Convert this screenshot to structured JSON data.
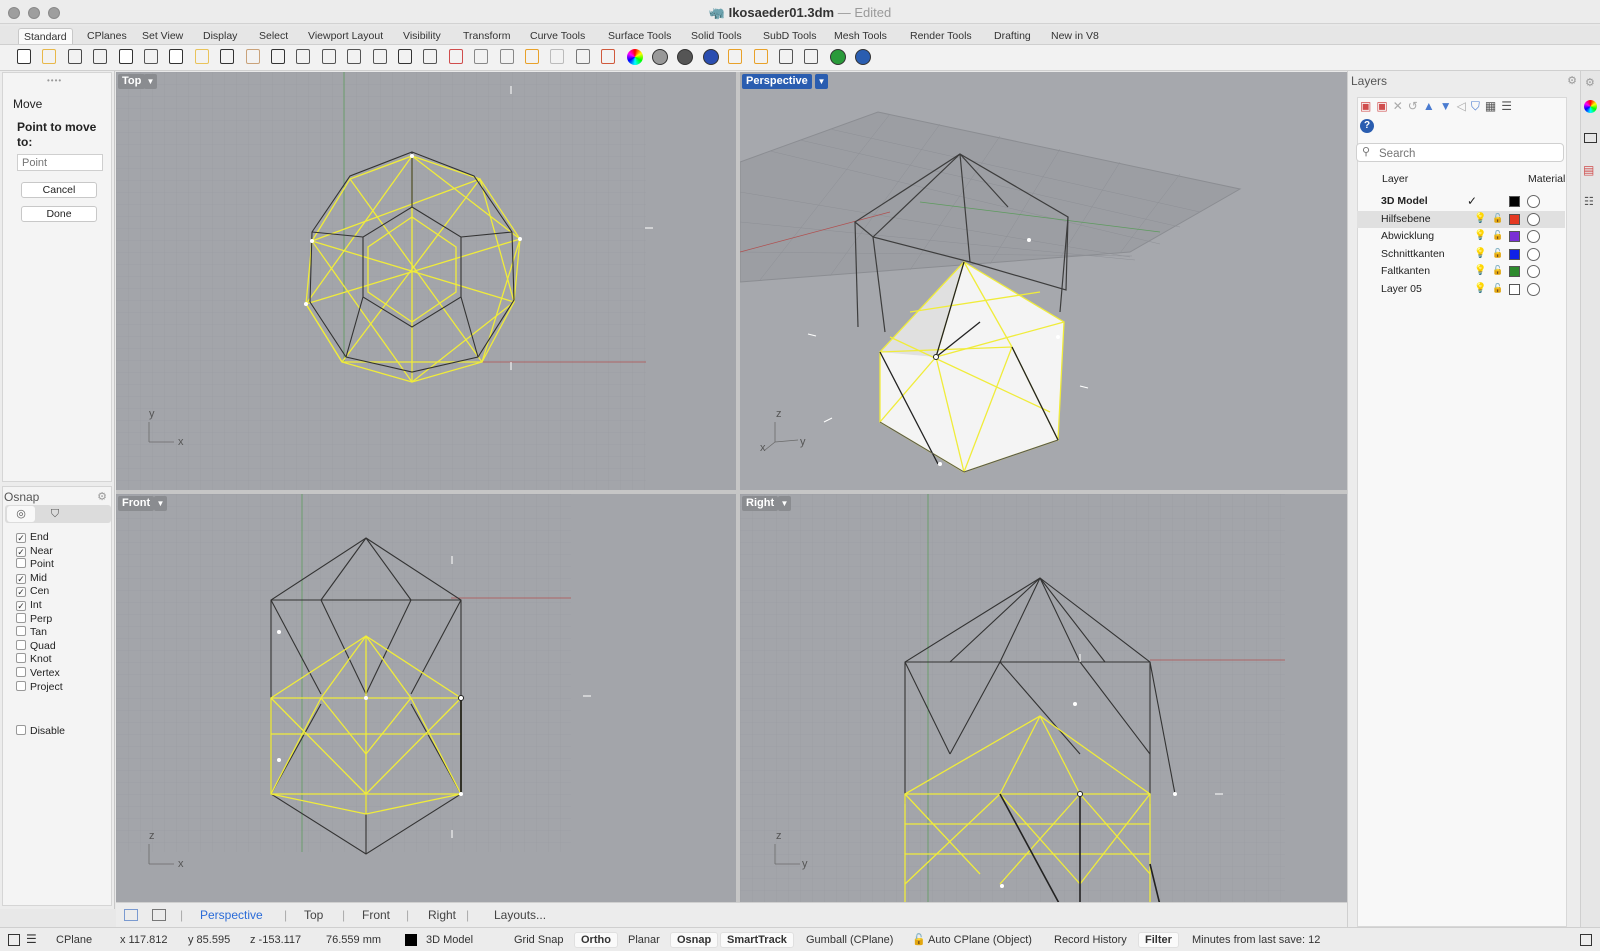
{
  "window": {
    "filename": "Ikosaeder01.3dm",
    "separator": "—",
    "state": "Edited"
  },
  "tabs": [
    "Standard",
    "CPlanes",
    "Set View",
    "Display",
    "Select",
    "Viewport Layout",
    "Visibility",
    "Transform",
    "Curve Tools",
    "Surface Tools",
    "Solid Tools",
    "SubD Tools",
    "Mesh Tools",
    "Render Tools",
    "Drafting",
    "New in V8"
  ],
  "command": {
    "title": "Move",
    "prompt": "Point to move to:",
    "placeholder": "Point",
    "cancel": "Cancel",
    "done": "Done"
  },
  "osnap": {
    "title": "Osnap",
    "items": [
      {
        "label": "End",
        "checked": true
      },
      {
        "label": "Near",
        "checked": true
      },
      {
        "label": "Point",
        "checked": false
      },
      {
        "label": "Mid",
        "checked": true
      },
      {
        "label": "Cen",
        "checked": true
      },
      {
        "label": "Int",
        "checked": true
      },
      {
        "label": "Perp",
        "checked": false
      },
      {
        "label": "Tan",
        "checked": false
      },
      {
        "label": "Quad",
        "checked": false
      },
      {
        "label": "Knot",
        "checked": false
      },
      {
        "label": "Vertex",
        "checked": false
      },
      {
        "label": "Project",
        "checked": false
      }
    ],
    "disable": "Disable"
  },
  "viewports": {
    "top": "Top",
    "perspective": "Perspective",
    "front": "Front",
    "right": "Right"
  },
  "viewport_tabs": {
    "perspective": "Perspective",
    "top": "Top",
    "front": "Front",
    "right": "Right",
    "layouts": "Layouts..."
  },
  "axes": {
    "x": "x",
    "y": "y",
    "z": "z"
  },
  "layers": {
    "title": "Layers",
    "search_placeholder": "Search",
    "col_layer": "Layer",
    "col_material": "Material",
    "current_mark": "✓",
    "rows": [
      {
        "name": "3D Model",
        "color": "#000000"
      },
      {
        "name": "Hilfsebene",
        "color": "#e53922"
      },
      {
        "name": "Abwicklung",
        "color": "#7a2fd6"
      },
      {
        "name": "Schnittkanten",
        "color": "#1021e8"
      },
      {
        "name": "Faltkanten",
        "color": "#2d8a2d"
      },
      {
        "name": "Layer 05",
        "color": "#ffffff"
      }
    ]
  },
  "status": {
    "cplane": "CPlane",
    "x": "x 117.812",
    "y": "y 85.595",
    "z": "z -153.117",
    "dist": "76.559 mm",
    "layer": "3D Model",
    "grid_snap": "Grid Snap",
    "ortho": "Ortho",
    "planar": "Planar",
    "osnap": "Osnap",
    "smarttrack": "SmartTrack",
    "gumball": "Gumball (CPlane)",
    "autocplane": "Auto CPlane (Object)",
    "record": "Record History",
    "filter": "Filter",
    "last_save": "Minutes from last save: 12"
  },
  "colors": {
    "wire_yellow": "#f0ec3a",
    "wire_dark": "#3a3a3a",
    "active_blue": "#2a5db0"
  }
}
